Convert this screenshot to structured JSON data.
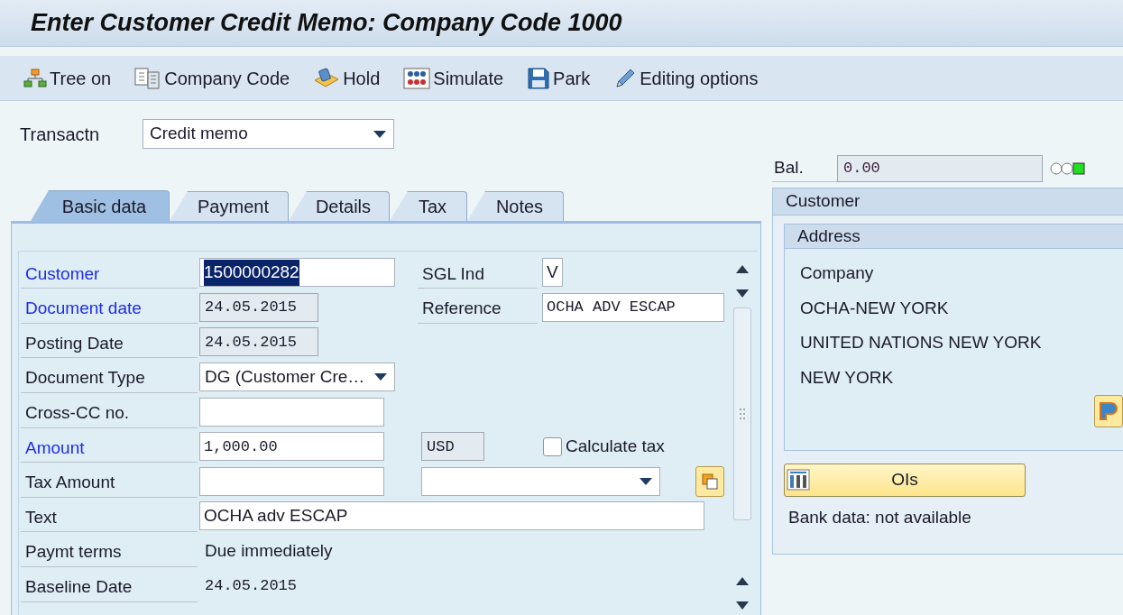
{
  "title": "Enter Customer Credit Memo: Company Code 1000",
  "toolbar": [
    {
      "label": "Tree on"
    },
    {
      "label": "Company Code"
    },
    {
      "label": "Hold"
    },
    {
      "label": "Simulate"
    },
    {
      "label": "Park"
    },
    {
      "label": "Editing options"
    }
  ],
  "transaction": {
    "label": "Transactn",
    "value": "Credit memo"
  },
  "tabs": [
    {
      "label": "Basic data",
      "selected": true
    },
    {
      "label": "Payment",
      "selected": false
    },
    {
      "label": "Details",
      "selected": false
    },
    {
      "label": "Tax",
      "selected": false
    },
    {
      "label": "Notes",
      "selected": false
    }
  ],
  "rows": [
    {
      "label": "Customer",
      "required": true,
      "field": {
        "kind": "input",
        "value": "1500000282",
        "highlighted": true
      },
      "extras": [
        {
          "kind": "label",
          "text": "SGL Ind"
        },
        {
          "kind": "input",
          "value": "V"
        }
      ]
    },
    {
      "label": "Document date",
      "required": true,
      "field": {
        "kind": "readonly",
        "value": "24.05.2015"
      },
      "extras": [
        {
          "kind": "label",
          "text": "Reference"
        },
        {
          "kind": "input",
          "value": "OCHA ADV ESCAP"
        }
      ]
    },
    {
      "label": "Posting Date",
      "required": false,
      "field": {
        "kind": "readonly",
        "value": "24.05.2015"
      }
    },
    {
      "label": "Document Type",
      "required": false,
      "field": {
        "kind": "dropdown",
        "value": "DG (Customer Cre…"
      }
    },
    {
      "label": "Cross-CC no.",
      "required": false,
      "field": {
        "kind": "input"
      }
    },
    {
      "label": "Amount",
      "required": true,
      "field": {
        "kind": "input",
        "value": "1,000.00"
      },
      "extras": [
        {
          "kind": "readonly",
          "value": "USD"
        },
        {
          "kind": "checkbox",
          "text": "Calculate tax",
          "checked": false
        }
      ]
    },
    {
      "label": "Tax Amount",
      "required": false,
      "field": {
        "kind": "input"
      },
      "extras": [
        {
          "kind": "dropdown"
        },
        {
          "kind": "icon_button"
        }
      ]
    },
    {
      "label": "Text",
      "required": false,
      "field": {
        "kind": "input",
        "value": "OCHA adv ESCAP"
      }
    },
    {
      "label": "Paymt terms",
      "required": false,
      "field": {
        "kind": "text",
        "value": "Due immediately"
      }
    },
    {
      "label": "Baseline Date",
      "required": false,
      "field": {
        "kind": "text",
        "value": "24.05.2015"
      }
    }
  ],
  "balance": {
    "label": "Bal.",
    "value": "0.00",
    "ok": true
  },
  "customer_panel": {
    "title": "Customer",
    "address": {
      "title": "Address",
      "lines": [
        "Company",
        "OCHA-NEW YORK",
        "UNITED NATIONS NEW YORK",
        "NEW YORK"
      ]
    },
    "button": "OIs",
    "bank_note": "Bank data: not available"
  }
}
